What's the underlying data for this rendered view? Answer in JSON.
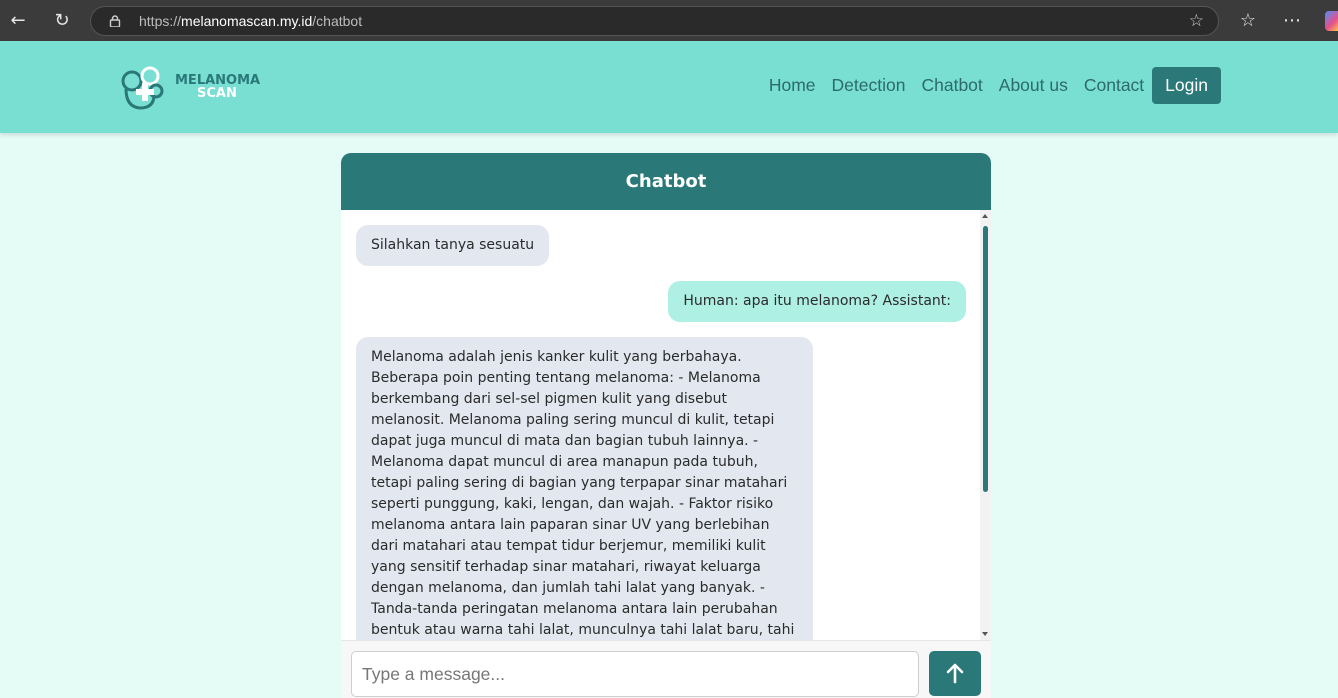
{
  "browser": {
    "url_scheme": "https://",
    "url_host": "melanomascan.my.id",
    "url_path": "/chatbot"
  },
  "header": {
    "logo_line1": "MELANOMA",
    "logo_line2": "SCAN",
    "nav": {
      "home": "Home",
      "detection": "Detection",
      "chatbot": "Chatbot",
      "about": "About us",
      "contact": "Contact"
    },
    "login_label": "Login"
  },
  "chat": {
    "title": "Chatbot",
    "messages": [
      {
        "role": "bot",
        "text": "Silahkan tanya sesuatu"
      },
      {
        "role": "user",
        "text": "Human: apa itu melanoma? Assistant:"
      },
      {
        "role": "bot",
        "text": "Melanoma adalah jenis kanker kulit yang berbahaya. Beberapa poin penting tentang melanoma: - Melanoma berkembang dari sel-sel pigmen kulit yang disebut melanosit. Melanoma paling sering muncul di kulit, tetapi dapat juga muncul di mata dan bagian tubuh lainnya. - Melanoma dapat muncul di area manapun pada tubuh, tetapi paling sering di bagian yang terpapar sinar matahari seperti punggung, kaki, lengan, dan wajah. - Faktor risiko melanoma antara lain paparan sinar UV yang berlebihan dari matahari atau tempat tidur berjemur, memiliki kulit yang sensitif terhadap sinar matahari, riwayat keluarga dengan melanoma, dan jumlah tahi lalat yang banyak. - Tanda-tanda peringatan melanoma antara lain perubahan bentuk atau warna tahi lalat, munculnya tahi lalat baru, tahi"
      }
    ],
    "input_placeholder": "Type a message..."
  },
  "colors": {
    "header_bg": "#78dfd2",
    "accent": "#2a7878",
    "page_bg": "#e5fbf6",
    "user_bubble": "#aef0e3",
    "bot_bubble": "#e3e8f0"
  }
}
